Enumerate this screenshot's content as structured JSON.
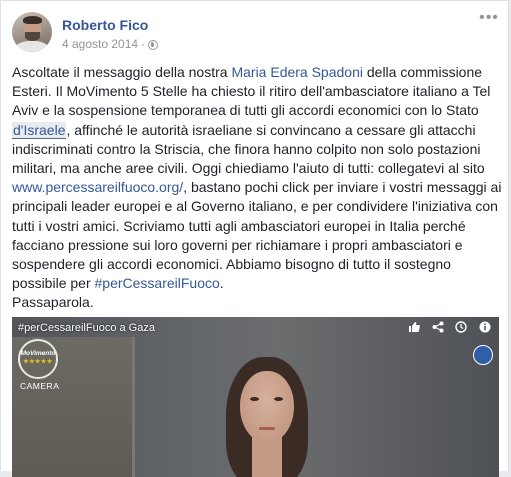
{
  "post": {
    "author": "Roberto Fico",
    "date": "4 agosto 2014",
    "separator": "·",
    "more_icon": "more-horizontal-icon",
    "privacy_icon": "globe-icon",
    "text": {
      "s1": "Ascoltate il messaggio della nostra ",
      "mention": "Maria Edera Spadoni",
      "s2": " della commissione Esteri. Il MoVimento 5 Stelle ha chiesto il ritiro dell'ambasciatore italiano a Tel Aviv e la sospensione temporanea di tutti gli accordi economici con lo Stato ",
      "page_link": "d'Israele",
      "s3": ", affinché le autorità israeliane si convincano a cessare gli attacchi indiscriminati contro la Striscia, che finora hanno colpito non solo postazioni militari, ma anche aree civili. Oggi chiediamo l'aiuto di tutti: collegatevi al sito ",
      "url": "www.percessareilfuoco.org/",
      "s4": ", bastano pochi click per inviare i vostri messaggi ai principali leader europei e al Governo italiano, e per condividere l'iniziativa con tutti i vostri amici. Scriviamo tutti agli ambasciatori europei in Italia perché facciano pressione sui loro governi per richiamare i propri ambasciatori e sospendere gli accordi economici. Abbiamo bisogno di tutto il sostegno possibile per ",
      "hashtag": "#perCessareilFuoco",
      "s5": ".",
      "closing": "Passaparola."
    }
  },
  "video": {
    "title": "#perCessareilFuoco a Gaza",
    "logo_text": "MoVimento",
    "logo_stars": "★★★★★",
    "logo_sub": "CAMERA",
    "icons": [
      "thumb-up-icon",
      "share-icon",
      "clock-icon",
      "info-icon"
    ]
  }
}
